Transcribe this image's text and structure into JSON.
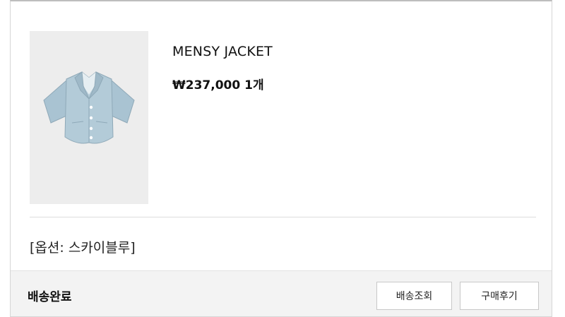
{
  "order": {
    "product_name": "MENSY JACKET",
    "price": "₩237,000",
    "quantity": "1개",
    "option": "[옵션: 스카이블루]",
    "status": "배송완료"
  },
  "actions": {
    "tracking_label": "배송조회",
    "review_label": "구매후기"
  },
  "image": {
    "subject": "short-sleeve sky blue jacket",
    "color": "#a9c3d2"
  }
}
